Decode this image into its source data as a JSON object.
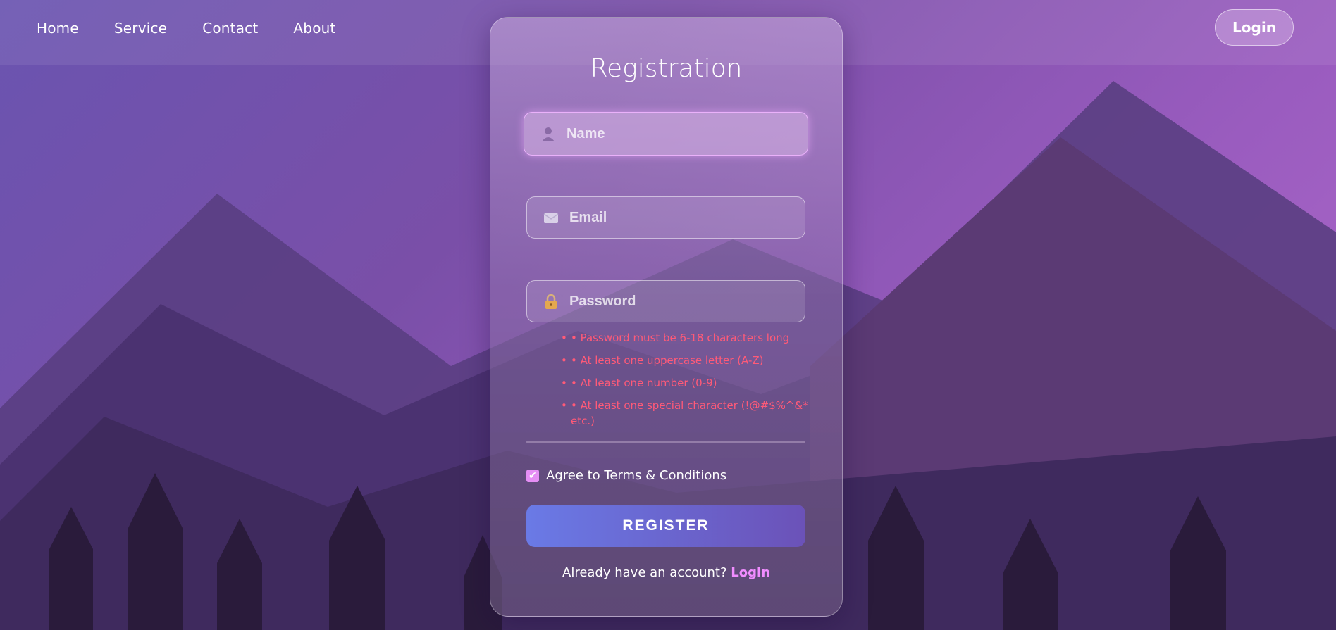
{
  "nav": {
    "items": [
      {
        "label": "Home"
      },
      {
        "label": "Service"
      },
      {
        "label": "Contact"
      },
      {
        "label": "About"
      }
    ],
    "login_label": "Login"
  },
  "form": {
    "title": "Registration",
    "name_placeholder": "Name",
    "email_placeholder": "Email",
    "password_placeholder": "Password",
    "password_rules": [
      "• Password must be 6-18 characters long",
      "• At least one uppercase letter (A-Z)",
      "• At least one number (0-9)",
      "• At least one special character (!@#$%^&* etc.)"
    ],
    "agree_label": "Agree to Terms & Conditions",
    "agree_checked": true,
    "register_label": "REGISTER",
    "footer_text": "Already have an account?",
    "footer_link": "Login"
  },
  "colors": {
    "accent": "#f08cff",
    "rule_text": "#ff5a78",
    "button_start": "#6a7ae6",
    "button_end": "#6b52b8"
  },
  "icons": {
    "name": "user-icon",
    "email": "envelope-icon",
    "password": "lock-icon"
  }
}
